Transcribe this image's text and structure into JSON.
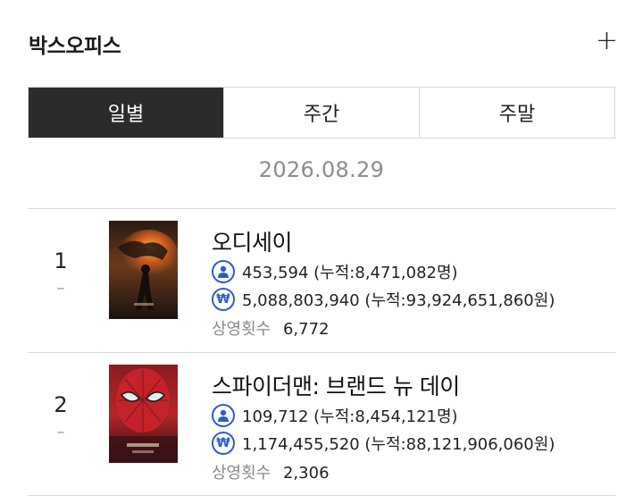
{
  "header": {
    "title": "박스오피스",
    "plus_icon": "plus-icon"
  },
  "tabs": [
    {
      "label": "일별",
      "active": true
    },
    {
      "label": "주간",
      "active": false
    },
    {
      "label": "주말",
      "active": false
    }
  ],
  "date": "2026.08.29",
  "colors": {
    "active_tab_bg": "#2b2b2b",
    "icon_blue": "#2a5fc9",
    "muted": "#8c8c8c"
  },
  "movies": [
    {
      "rank": "1",
      "change": "–",
      "title": "오디세이",
      "audience": "453,594 (누적:8,471,082명)",
      "revenue": "5,088,803,940 (누적:93,924,651,860원)",
      "shows_label": "상영횟수",
      "shows_value": "6,772"
    },
    {
      "rank": "2",
      "change": "–",
      "title": "스파이더맨: 브랜드 뉴 데이",
      "audience": "109,712 (누적:8,454,121명)",
      "revenue": "1,174,455,520 (누적:88,121,906,060원)",
      "shows_label": "상영횟수",
      "shows_value": "2,306"
    }
  ],
  "icons": {
    "audience": "person-icon",
    "revenue": "won-icon"
  }
}
